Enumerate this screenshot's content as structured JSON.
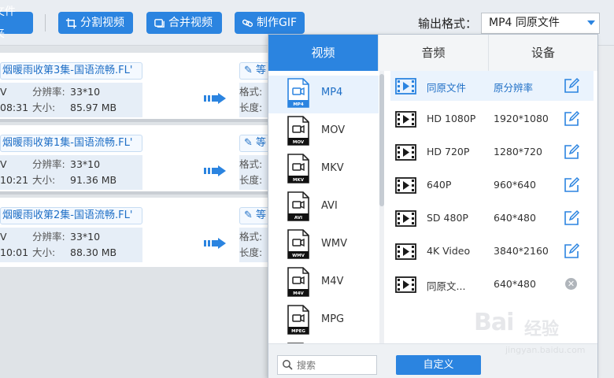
{
  "toolbar": {
    "folder_label": "文件夹",
    "split_label": "分割视频",
    "merge_label": "合并视频",
    "gif_label": "制作GIF",
    "output_label": "输出格式：",
    "output_value": "MP4  同原文件"
  },
  "files": [
    {
      "name": "烟暖雨收第3集-国语流畅.FL'",
      "line1_left": "V",
      "line2_left": "08:31",
      "res_label": "分辨率:",
      "res_value": "33*10",
      "size_label": "大小:",
      "size_value": "85.97 MB",
      "right_chip": "等",
      "fmt_label": "格式:",
      "len_label": "长度:"
    },
    {
      "name": "烟暖雨收第1集-国语流畅.FL'",
      "line1_left": "V",
      "line2_left": "10:21",
      "res_label": "分辨率:",
      "res_value": "33*10",
      "size_label": "大小:",
      "size_value": "91.36 MB",
      "right_chip": "等",
      "fmt_label": "格式:",
      "len_label": "长度:"
    },
    {
      "name": "烟暖雨收第2集-国语流畅.FL'",
      "line1_left": "V",
      "line2_left": "10:01",
      "res_label": "分辨率:",
      "res_value": "33*10",
      "size_label": "大小:",
      "size_value": "88.30 MB",
      "right_chip": "等",
      "fmt_label": "格式:",
      "len_label": "长度:"
    }
  ],
  "popup": {
    "tabs": [
      {
        "label": "视频",
        "active": true
      },
      {
        "label": "音频",
        "active": false
      },
      {
        "label": "设备",
        "active": false
      }
    ],
    "formats": [
      {
        "name": "MP4",
        "tag": "MP4",
        "selected": true
      },
      {
        "name": "MOV",
        "tag": "MOV",
        "selected": false
      },
      {
        "name": "MKV",
        "tag": "MKV",
        "selected": false
      },
      {
        "name": "AVI",
        "tag": "AVI",
        "selected": false
      },
      {
        "name": "WMV",
        "tag": "WMV",
        "selected": false
      },
      {
        "name": "M4V",
        "tag": "M4V",
        "selected": false
      },
      {
        "name": "MPG",
        "tag": "MPEG",
        "selected": false
      }
    ],
    "qualities": [
      {
        "name": "同原文件",
        "res": "原分辨率",
        "action": "edit",
        "selected": true
      },
      {
        "name": "HD 1080P",
        "res": "1920*1080",
        "action": "edit",
        "selected": false
      },
      {
        "name": "HD 720P",
        "res": "1280*720",
        "action": "edit",
        "selected": false
      },
      {
        "name": "640P",
        "res": "960*640",
        "action": "edit",
        "selected": false
      },
      {
        "name": "SD 480P",
        "res": "640*480",
        "action": "edit",
        "selected": false
      },
      {
        "name": "4K Video",
        "res": "3840*2160",
        "action": "edit",
        "selected": false
      },
      {
        "name": "同原文...",
        "res": "640*480",
        "action": "delete",
        "selected": false
      }
    ],
    "search_placeholder": "搜索",
    "custom_label": "自定义"
  },
  "watermark": {
    "brand": "Bai",
    "sub": "经验",
    "url": "jingyan.baidu.com"
  },
  "colors": {
    "accent": "#2b84e0",
    "selected_bg": "#e8f2fd",
    "link": "#1f6fc6"
  }
}
